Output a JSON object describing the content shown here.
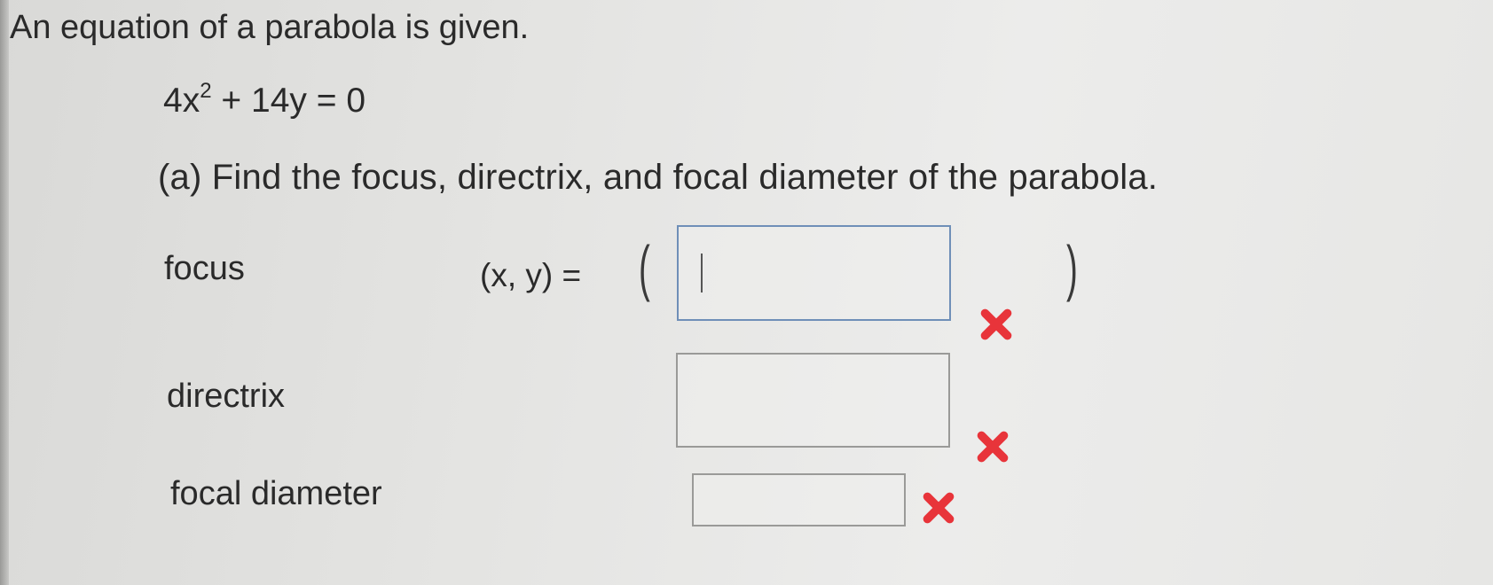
{
  "question": {
    "prompt": "An equation of a parabola is given.",
    "equation": {
      "lhs_coef": "4x",
      "exponent": "2",
      "rest": " + 14y = 0"
    },
    "part_a": "(a) Find the focus, directrix, and focal diameter of the parabola."
  },
  "fields": {
    "focus": {
      "label": "focus",
      "prefix": "(x, y) =",
      "value": "",
      "status": "incorrect"
    },
    "directrix": {
      "label": "directrix",
      "value": "",
      "status": "incorrect"
    },
    "focal_diameter": {
      "label": "focal diameter",
      "value": "",
      "status": "incorrect"
    }
  },
  "colors": {
    "incorrect_mark": "#e8343a",
    "focused_border": "#6f8fb8"
  },
  "icons": {
    "incorrect": "x-mark-icon"
  }
}
